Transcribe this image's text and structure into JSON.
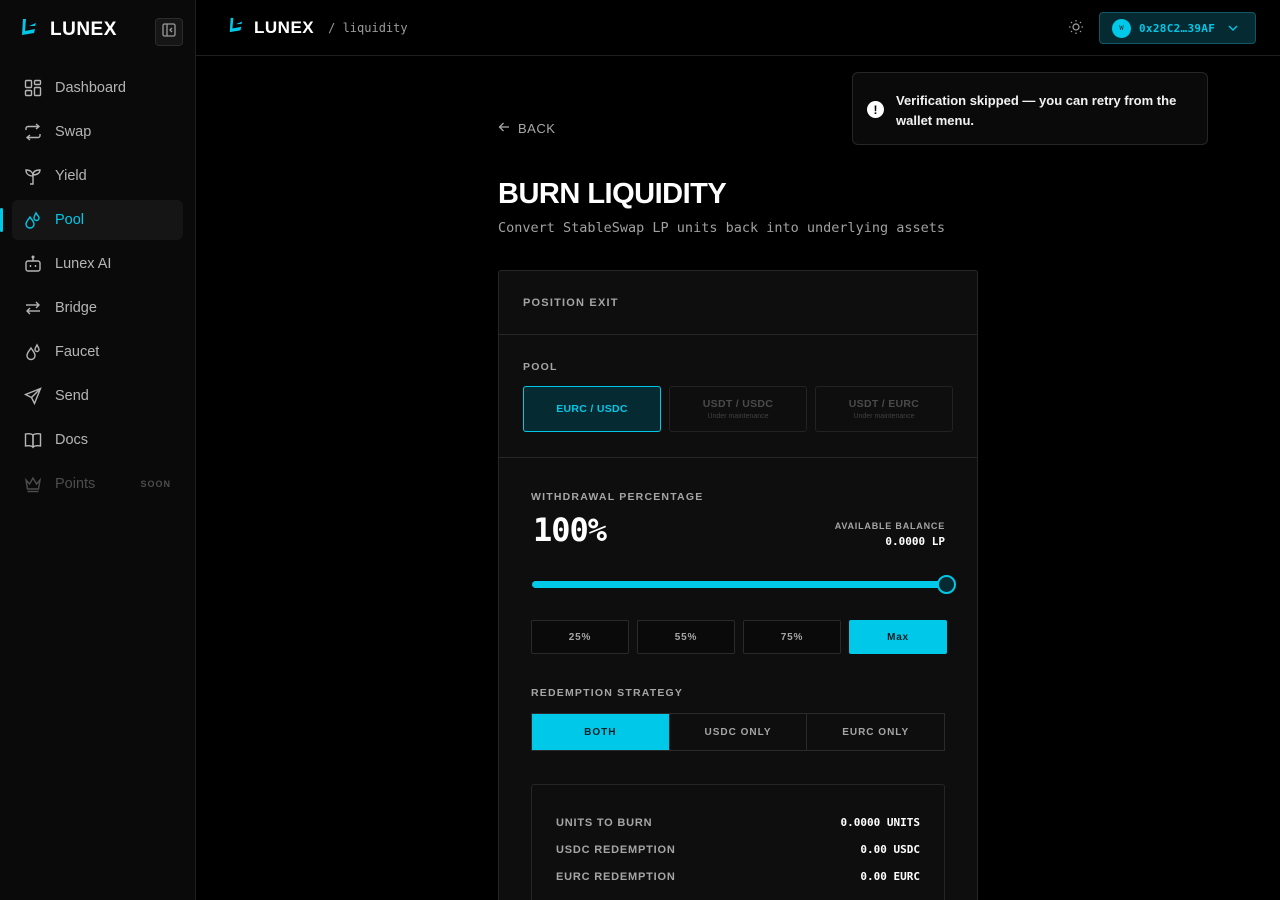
{
  "app": {
    "name": "LUNEX",
    "breadcrumb": "/ liquidity"
  },
  "colors": {
    "accent": "#00c8e8",
    "background": "#000000",
    "panel": "#0e0e0e"
  },
  "sidebar": {
    "items": [
      {
        "label": "Dashboard",
        "icon": "dashboard-icon"
      },
      {
        "label": "Swap",
        "icon": "swap-icon"
      },
      {
        "label": "Yield",
        "icon": "sprout-icon"
      },
      {
        "label": "Pool",
        "icon": "droplets-icon",
        "active": true
      },
      {
        "label": "Lunex AI",
        "icon": "bot-icon"
      },
      {
        "label": "Bridge",
        "icon": "bridge-arrows-icon"
      },
      {
        "label": "Faucet",
        "icon": "faucet-drops-icon"
      },
      {
        "label": "Send",
        "icon": "send-icon"
      },
      {
        "label": "Docs",
        "icon": "book-icon"
      },
      {
        "label": "Points",
        "icon": "crown-icon",
        "disabled": true,
        "badge": "SOON"
      }
    ]
  },
  "header": {
    "wallet_avatar": "W",
    "wallet_address": "0x28C2…39AF"
  },
  "toast": {
    "message": "Verification skipped — you can retry from the wallet menu."
  },
  "main": {
    "back_label": "BACK",
    "title": "BURN LIQUIDITY",
    "subtitle": "Convert StableSwap LP units back into underlying assets"
  },
  "card": {
    "header": "POSITION EXIT",
    "pool_label": "POOL",
    "pools": [
      {
        "name": "EURC / USDC",
        "note": "",
        "selected": true
      },
      {
        "name": "USDT / USDC",
        "note": "Under maintenance",
        "selected": false
      },
      {
        "name": "USDT / EURC",
        "note": "Under maintenance",
        "selected": false
      }
    ],
    "withdrawal_label": "WITHDRAWAL PERCENTAGE",
    "withdrawal_percent_text": "100%",
    "withdrawal_percent": 100,
    "available_balance_label": "AVAILABLE BALANCE",
    "available_balance": "0.0000 LP",
    "quick_buttons": [
      "25%",
      "55%",
      "75%",
      "Max"
    ],
    "quick_selected": 3,
    "strategy_label": "REDEMPTION STRATEGY",
    "strategies": [
      "BOTH",
      "USDC ONLY",
      "EURC ONLY"
    ],
    "strategy_selected": 0,
    "summary": [
      {
        "key": "UNITS TO BURN",
        "value": "0.0000 UNITS"
      },
      {
        "key": "USDC REDEMPTION",
        "value": "0.00 USDC"
      },
      {
        "key": "EURC REDEMPTION",
        "value": "0.00 EURC"
      }
    ]
  }
}
